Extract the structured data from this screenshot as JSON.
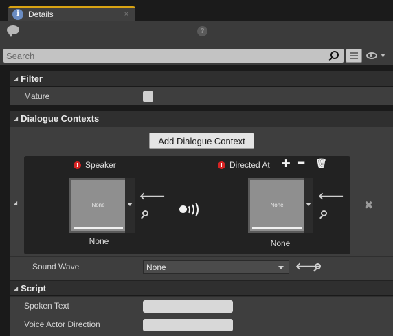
{
  "tab": {
    "title": "Details",
    "close": "×"
  },
  "toolbar": {
    "help_glyph": "?"
  },
  "search": {
    "placeholder": "Search",
    "value": ""
  },
  "categories": {
    "filter": {
      "label": "Filter"
    },
    "dialogue_contexts": {
      "label": "Dialogue Contexts"
    },
    "script": {
      "label": "Script"
    }
  },
  "filter_props": {
    "mature_label": "Mature"
  },
  "dialogue": {
    "add_button_label": "Add Dialogue Context",
    "speaker": {
      "label": "Speaker",
      "thumb_placeholder": "None",
      "value": "None"
    },
    "directed_at": {
      "label": "Directed At",
      "thumb_placeholder": "None",
      "value": "None"
    },
    "sound_wave": {
      "label": "Sound Wave",
      "value": "None"
    }
  },
  "script_props": {
    "spoken_text_label": "Spoken Text",
    "spoken_text_value": "",
    "voice_direction_label": "Voice Actor Direction",
    "voice_direction_value": ""
  },
  "icons": {
    "tab": "details-icon",
    "comment": "comment-icon",
    "help": "help-icon",
    "search": "search-icon",
    "view_options": "view-options-icon",
    "eye": "eye-icon",
    "warning": "warning-icon",
    "speech": "speaking-icon",
    "add": "plus-icon",
    "remove": "minus-icon",
    "delete": "trash-icon",
    "remove_context": "close-icon"
  },
  "colors": {
    "accent": "#d9a313",
    "warning": "#d62323",
    "panel": "#3e3e3e",
    "header": "#2f2f2f"
  }
}
